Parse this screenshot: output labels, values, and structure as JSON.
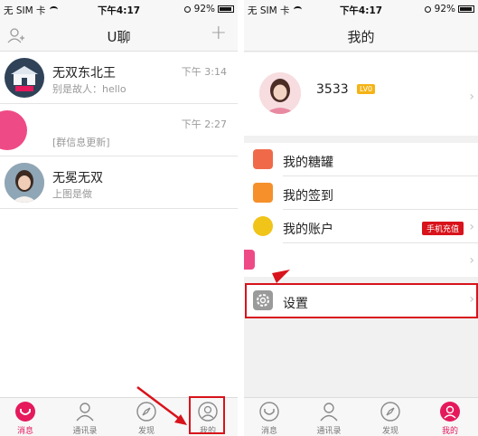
{
  "status": {
    "carrier": "无 SIM 卡",
    "time": "下午4:17",
    "battery": "92%"
  },
  "left": {
    "title": "U聊",
    "conversations": [
      {
        "name": "无双东北王",
        "message": "别是故人：hello",
        "time": "下午 3:14"
      },
      {
        "name": "",
        "message": "[群信息更新]",
        "time": "下午 2:27"
      },
      {
        "name": "无冕无双",
        "message": "上图是做",
        "time": ""
      }
    ]
  },
  "right": {
    "title": "我的",
    "profile": {
      "name": "3533",
      "level": "LV0"
    },
    "menu": [
      {
        "label": "我的糖罐",
        "icon": "candy-jar-icon",
        "color": "#f06a4a"
      },
      {
        "label": "我的签到",
        "icon": "checkin-calendar-icon",
        "color": "#f5902a"
      },
      {
        "label": "我的账户",
        "icon": "account-coin-icon",
        "color": "#f0c419",
        "badge": "手机充值"
      },
      {
        "label": "",
        "icon": "pink-icon",
        "color": "#ee4a86"
      },
      {
        "label": "设置",
        "icon": "gear-icon",
        "color": "#9a9a9a"
      }
    ]
  },
  "tabs": [
    "消息",
    "通讯录",
    "发现",
    "我的"
  ],
  "colors": {
    "accent": "#e5195c",
    "annotation": "#d8131b"
  }
}
